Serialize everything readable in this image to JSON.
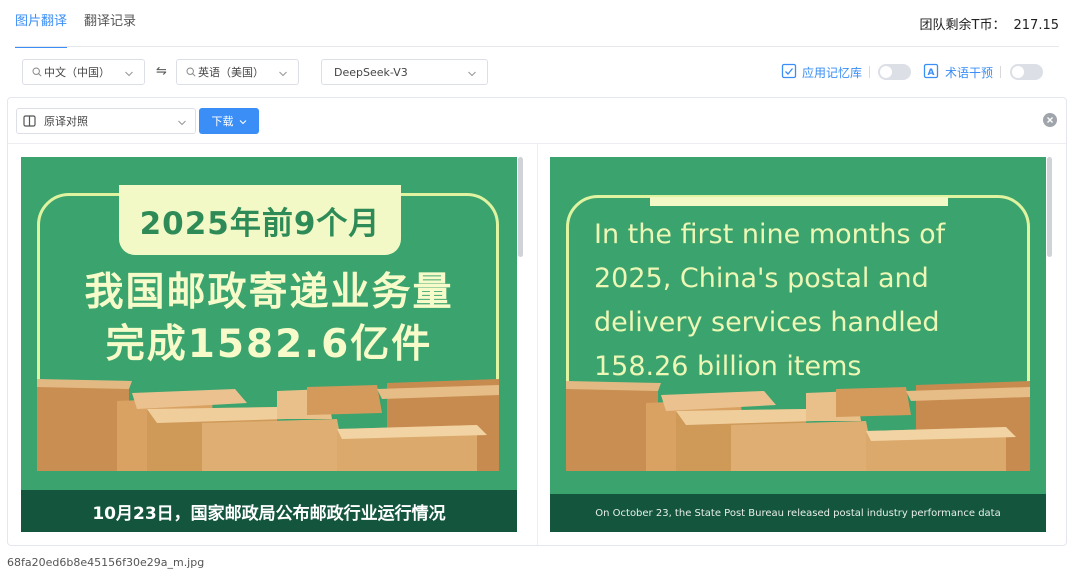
{
  "header": {
    "tabs": [
      {
        "label": "图片翻译",
        "active": true
      },
      {
        "label": "翻译记录",
        "active": false
      }
    ],
    "credits_label": "团队剩余T币：",
    "credits_value": "217.15"
  },
  "toolbar": {
    "source_lang": "中文（中国）",
    "target_lang": "英语（美国）",
    "swap_symbol": "⇋",
    "model": "DeepSeek-V3",
    "memory_label": "应用记忆库",
    "memory_enabled": false,
    "term_label": "术语干预",
    "term_enabled": false
  },
  "panel": {
    "view_mode": "原译对照",
    "download_label": "下载"
  },
  "source_image": {
    "ribbon": "2025年前9个月",
    "headline_line1": "我国邮政寄递业务量",
    "headline_line2": "完成1582.6亿件",
    "footer": "10月23日，国家邮政局公布邮政行业运行情况"
  },
  "translated_image": {
    "headline": "In the first nine months of 2025, China's postal and delivery services handled 158.26 billion items",
    "footer": "On October 23, the State Post Bureau released postal industry performance data"
  },
  "filename": "68fa20ed6b8e45156f30e29a_m.jpg",
  "colors": {
    "accent": "#3a8ef6",
    "poster_green": "#3aa36e",
    "poster_band": "#13553d"
  }
}
